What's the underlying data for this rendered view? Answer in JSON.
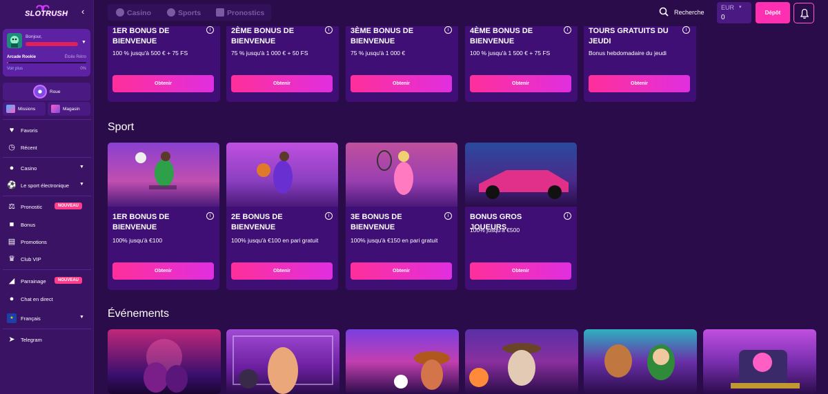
{
  "brand": {
    "name": "SLOTRUSH"
  },
  "sidebar": {
    "profile": {
      "greeting": "Bonjour,",
      "level": "Arcade Rookie",
      "next_level": "Étoile Rétro",
      "see_more": "Voir plus",
      "progress": "0%",
      "progress_value": 0.02
    },
    "roue": "Roue",
    "missions": "Missions",
    "shop": "Magasin",
    "items": {
      "favorites": "Favoris",
      "recent": "Récent",
      "casino": "Casino",
      "esport": "Le sport électronique",
      "pronostic": "Pronostic",
      "pronostic_badge": "NOUVEAU",
      "bonus": "Bonus",
      "promotions": "Promotions",
      "vip": "Club VIP",
      "referral": "Parrainage",
      "referral_badge": "NOUVEAU",
      "chat": "Chat en direct",
      "language": "Français",
      "telegram": "Telegram"
    }
  },
  "topbar": {
    "tabs": [
      "Casino",
      "Sports",
      "Pronostics"
    ],
    "search_label": "Recherche",
    "currency": "EUR",
    "balance": "0",
    "deposit": "Dépôt"
  },
  "casino_bonuses": [
    {
      "title": "1ER BONUS DE BIENVENUE",
      "desc": "100 % jusqu'à 500 € + 75 FS",
      "cta": "Obtenir"
    },
    {
      "title": "2ÈME BONUS DE BIENVENUE",
      "desc": "75 % jusqu'à 1 000 € + 50 FS",
      "cta": "Obtenir"
    },
    {
      "title": "3ÈME BONUS DE BIENVENUE",
      "desc": "75 % jusqu'à 1 000 €",
      "cta": "Obtenir"
    },
    {
      "title": "4ÈME BONUS DE BIENVENUE",
      "desc": "100 % jusqu'à 1 500 € + 75 FS",
      "cta": "Obtenir"
    },
    {
      "title": "TOURS GRATUITS DU JEUDI",
      "desc": "Bonus hebdomadaire du jeudi",
      "cta": "Obtenir"
    }
  ],
  "sport_section": {
    "title": "Sport"
  },
  "sport_bonuses": [
    {
      "title": "1ER BONUS DE BIENVENUE",
      "desc": "100% jusqu'à €100",
      "cta": "Obtenir"
    },
    {
      "title": "2E BONUS DE BIENVENUE",
      "desc": "100% jusqu'à €100 en pari gratuit",
      "cta": "Obtenir"
    },
    {
      "title": "3E BONUS DE BIENVENUE",
      "desc": "100% jusqu'à €150 en pari gratuit",
      "cta": "Obtenir"
    },
    {
      "title": "BONUS GROS JOUEURS",
      "desc": "100% jusqu'à €500",
      "cta": "Obtenir"
    }
  ],
  "events_section": {
    "title": "Événements"
  },
  "colors": {
    "accent": "#ff2fb1",
    "bg": "#2a0c4a",
    "card": "#3f0f76",
    "sidebar": "#3a1365"
  }
}
